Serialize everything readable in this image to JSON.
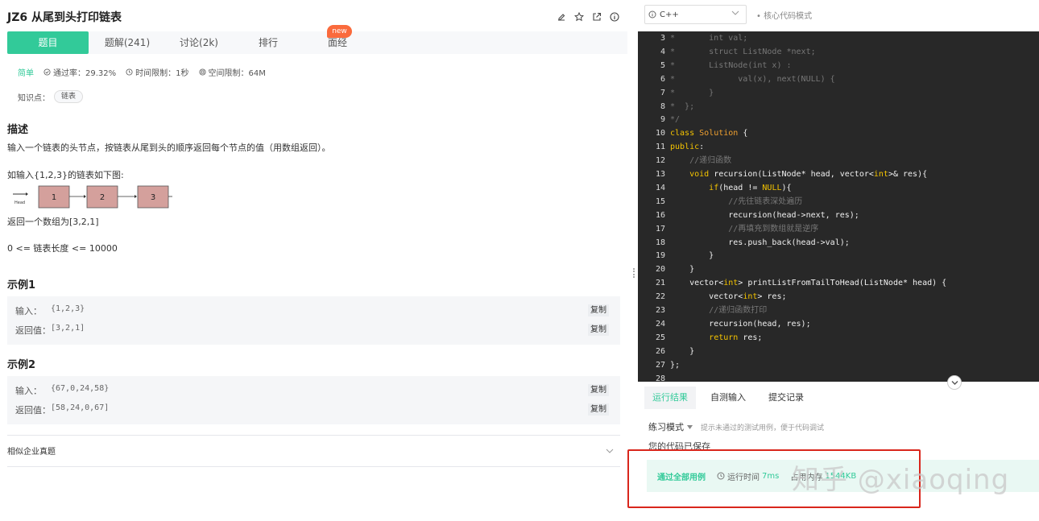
{
  "problem": {
    "id_title": "JZ6  从尾到头打印链表",
    "difficulty": "简单",
    "pass_rate": "通过率：29.32%",
    "time_limit": "时间限制：1秒",
    "space_limit": "空间限制：64M",
    "knowledge_label": "知识点：",
    "knowledge_tag": "链表"
  },
  "tabs": [
    {
      "label": "题目"
    },
    {
      "label": "题解(241)"
    },
    {
      "label": "讨论(2k)"
    },
    {
      "label": "排行"
    },
    {
      "label": "面经"
    }
  ],
  "new_badge": "new",
  "description": {
    "heading": "描述",
    "text": "输入一个链表的头节点，按链表从尾到头的顺序返回每个节点的值（用数组返回）。",
    "example_intro": "如输入{1,2,3}的链表如下图:",
    "head_label": "Head",
    "nodes": [
      "1",
      "2",
      "3"
    ],
    "return_text": "返回一个数组为[3,2,1]",
    "constraint": "0 <= 链表长度 <= 10000"
  },
  "examples": [
    {
      "heading": "示例1",
      "input_label": "输入：",
      "input": "{1,2,3}",
      "output_label": "返回值：",
      "output": "[3,2,1]",
      "copy": "复制"
    },
    {
      "heading": "示例2",
      "input_label": "输入：",
      "input": "{67,0,24,58}",
      "output_label": "返回值：",
      "output": "[58,24,0,67]",
      "copy": "复制"
    }
  ],
  "similar_label": "相似企业真题",
  "editor": {
    "language": "C++",
    "mode": "• 核心代码模式"
  },
  "code_lines": [
    {
      "n": "3",
      "t": "*       int val;"
    },
    {
      "n": "4",
      "t": "*       struct ListNode *next;"
    },
    {
      "n": "5",
      "t": "*       ListNode(int x) :"
    },
    {
      "n": "6",
      "t": "*             val(x), next(NULL) {"
    },
    {
      "n": "7",
      "t": "*       }"
    },
    {
      "n": "8",
      "t": "*  };"
    },
    {
      "n": "9",
      "t": "*/"
    },
    {
      "n": "10",
      "t": "class Solution {"
    },
    {
      "n": "11",
      "t": "public:"
    },
    {
      "n": "12",
      "t": "    //递归函数"
    },
    {
      "n": "13",
      "t": "    void recursion(ListNode* head, vector<int>& res){"
    },
    {
      "n": "14",
      "t": "        if(head != NULL){"
    },
    {
      "n": "15",
      "t": "            //先往链表深处遍历"
    },
    {
      "n": "16",
      "t": "            recursion(head->next, res);"
    },
    {
      "n": "17",
      "t": "            //再填充到数组就是逆序"
    },
    {
      "n": "18",
      "t": "            res.push_back(head->val);"
    },
    {
      "n": "19",
      "t": "        }"
    },
    {
      "n": "20",
      "t": "    }"
    },
    {
      "n": "21",
      "t": "    vector<int> printListFromTailToHead(ListNode* head) {"
    },
    {
      "n": "22",
      "t": "        vector<int> res;"
    },
    {
      "n": "23",
      "t": "        //递归函数打印"
    },
    {
      "n": "24",
      "t": "        recursion(head, res);"
    },
    {
      "n": "25",
      "t": "        return res;"
    },
    {
      "n": "26",
      "t": "    }"
    },
    {
      "n": "27",
      "t": "};"
    },
    {
      "n": "28",
      "t": ""
    }
  ],
  "result_tabs": [
    {
      "label": "运行结果"
    },
    {
      "label": "自测输入"
    },
    {
      "label": "提交记录"
    }
  ],
  "practice": {
    "label": "练习模式",
    "hint": "提示未通过的测试用例，便于代码调试",
    "saved": "您的代码已保存"
  },
  "result": {
    "status": "通过全部用例",
    "time_label": "运行时间",
    "time_value": "7ms",
    "mem_label": "占用内存",
    "mem_value": "1544KB"
  },
  "watermark": "知乎 @xiaoqing",
  "colors": {
    "accent": "#32ca99",
    "badge": "#fa6a3c",
    "editor_bg": "#282828",
    "highlight_frame": "#d9261c"
  }
}
